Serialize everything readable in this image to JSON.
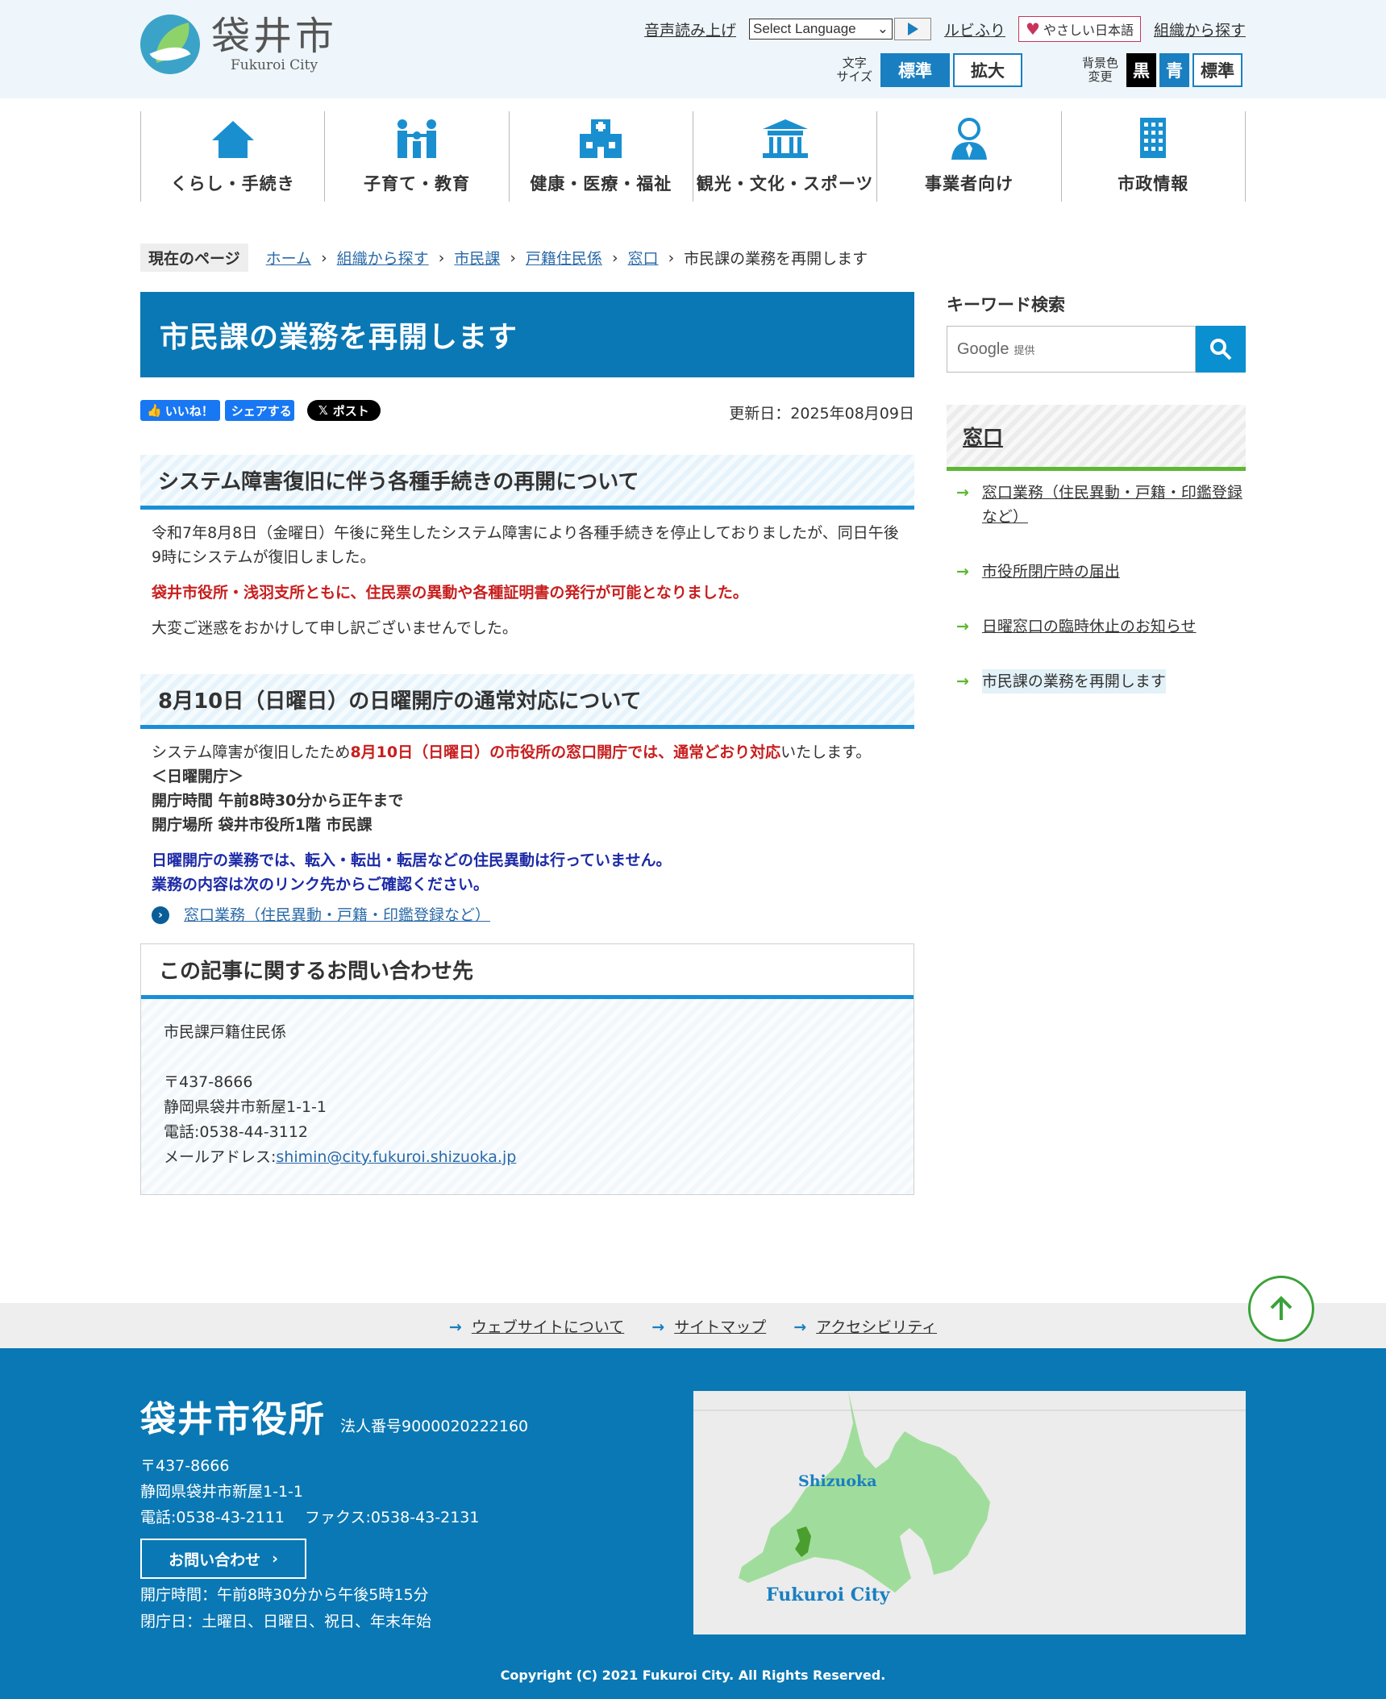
{
  "header": {
    "logo_jp": "袋井市",
    "logo_en": "Fukuroi City",
    "voice": "音声読み上げ",
    "language": "Select Language",
    "ruby": "ルビふり",
    "easy_jp": "やさしい日本語",
    "org_search": "組織から探す",
    "font_size_label1": "文字",
    "font_size_label2": "サイズ",
    "size_standard": "標準",
    "size_large": "拡大",
    "bg_label1": "背景色",
    "bg_label2": "変更",
    "bg_black": "黒",
    "bg_blue": "青",
    "bg_standard": "標準"
  },
  "nav": [
    {
      "label": "くらし・手続き",
      "icon": "home-icon"
    },
    {
      "label": "子育て・教育",
      "icon": "family-icon"
    },
    {
      "label": "健康・医療・福祉",
      "icon": "hospital-icon"
    },
    {
      "label": "観光・文化・スポーツ",
      "icon": "temple-icon"
    },
    {
      "label": "事業者向け",
      "icon": "businessperson-icon"
    },
    {
      "label": "市政情報",
      "icon": "building-icon"
    }
  ],
  "breadcrumb": {
    "current_label": "現在のページ",
    "items": [
      "ホーム",
      "組織から探す",
      "市民課",
      "戸籍住民係",
      "窓口"
    ],
    "last": "市民課の業務を再開します"
  },
  "main": {
    "title": "市民課の業務を再開します",
    "like": "いいね！",
    "share": "シェアする",
    "post": "ポスト",
    "updated": "更新日：2025年08月09日",
    "section1": {
      "heading": "システム障害復旧に伴う各種手続きの再開について",
      "p1": "令和7年8月8日（金曜日）午後に発生したシステム障害により各種手続きを停止しておりましたが、同日午後9時にシステムが復旧しました。",
      "p2": "袋井市役所・浅羽支所ともに、住民票の異動や各種証明書の発行が可能となりました。",
      "p3": "大変ご迷惑をおかけして申し訳ございませんでした。"
    },
    "section2": {
      "heading": "8月10日（日曜日）の日曜開庁の通常対応について",
      "p1_a": "システム障害が復旧したため",
      "p1_b": "8月10日（日曜日）の市役所の窓口開庁では、通常どおり対応",
      "p1_c": "いたします。",
      "line1": "＜日曜開庁＞",
      "line2": "開庁時間 午前8時30分から正午まで",
      "line3": "開庁場所 袋井市役所1階 市民課",
      "blue1": "日曜開庁の業務では、転入・転出・転居などの住民異動は行っていません。",
      "blue2": "業務の内容は次のリンク先からご確認ください。",
      "link": "窓口業務（住民異動・戸籍・印鑑登録など）"
    },
    "contact": {
      "heading": "この記事に関するお問い合わせ先",
      "dept": "市民課戸籍住民係",
      "zip": "〒437-8666",
      "address": "静岡県袋井市新屋1-1-1",
      "tel": "電話:0538-44-3112",
      "mail_label": "メールアドレス:",
      "mail": "shimin@city.fukuroi.shizuoka.jp"
    }
  },
  "side": {
    "keyword_title": "キーワード検索",
    "search_brand": "Google",
    "search_suffix": "提供",
    "menu_title": "窓口",
    "items": [
      "窓口業務（住民異動・戸籍・印鑑登録など）",
      "市役所閉庁時の届出",
      "日曜窓口の臨時休止のお知らせ",
      "市民課の業務を再開します"
    ]
  },
  "footer": {
    "links": [
      "ウェブサイトについて",
      "サイトマップ",
      "アクセシビリティ"
    ],
    "name": "袋井市役所",
    "corp_no": "法人番号9000020222160",
    "zip": "〒437-8666",
    "address": "静岡県袋井市新屋1-1-1",
    "tel_fax": "電話:0538-43-2111　 ファクス:0538-43-2131",
    "contact_btn": "お問い合わせ",
    "hours": "開庁時間：午前8時30分から午後5時15分",
    "closed": "閉庁日：土曜日、日曜日、祝日、年末年始",
    "map_label1": "Shizuoka",
    "map_label2": "Fukuroi City",
    "copyright": "Copyright (C) 2021 Fukuroi City. All Rights Reserved."
  },
  "colors": {
    "primary": "#0a78b4",
    "accent_green": "#5cb833",
    "alert_red": "#c81e1e",
    "navy": "#1c2aa6"
  }
}
